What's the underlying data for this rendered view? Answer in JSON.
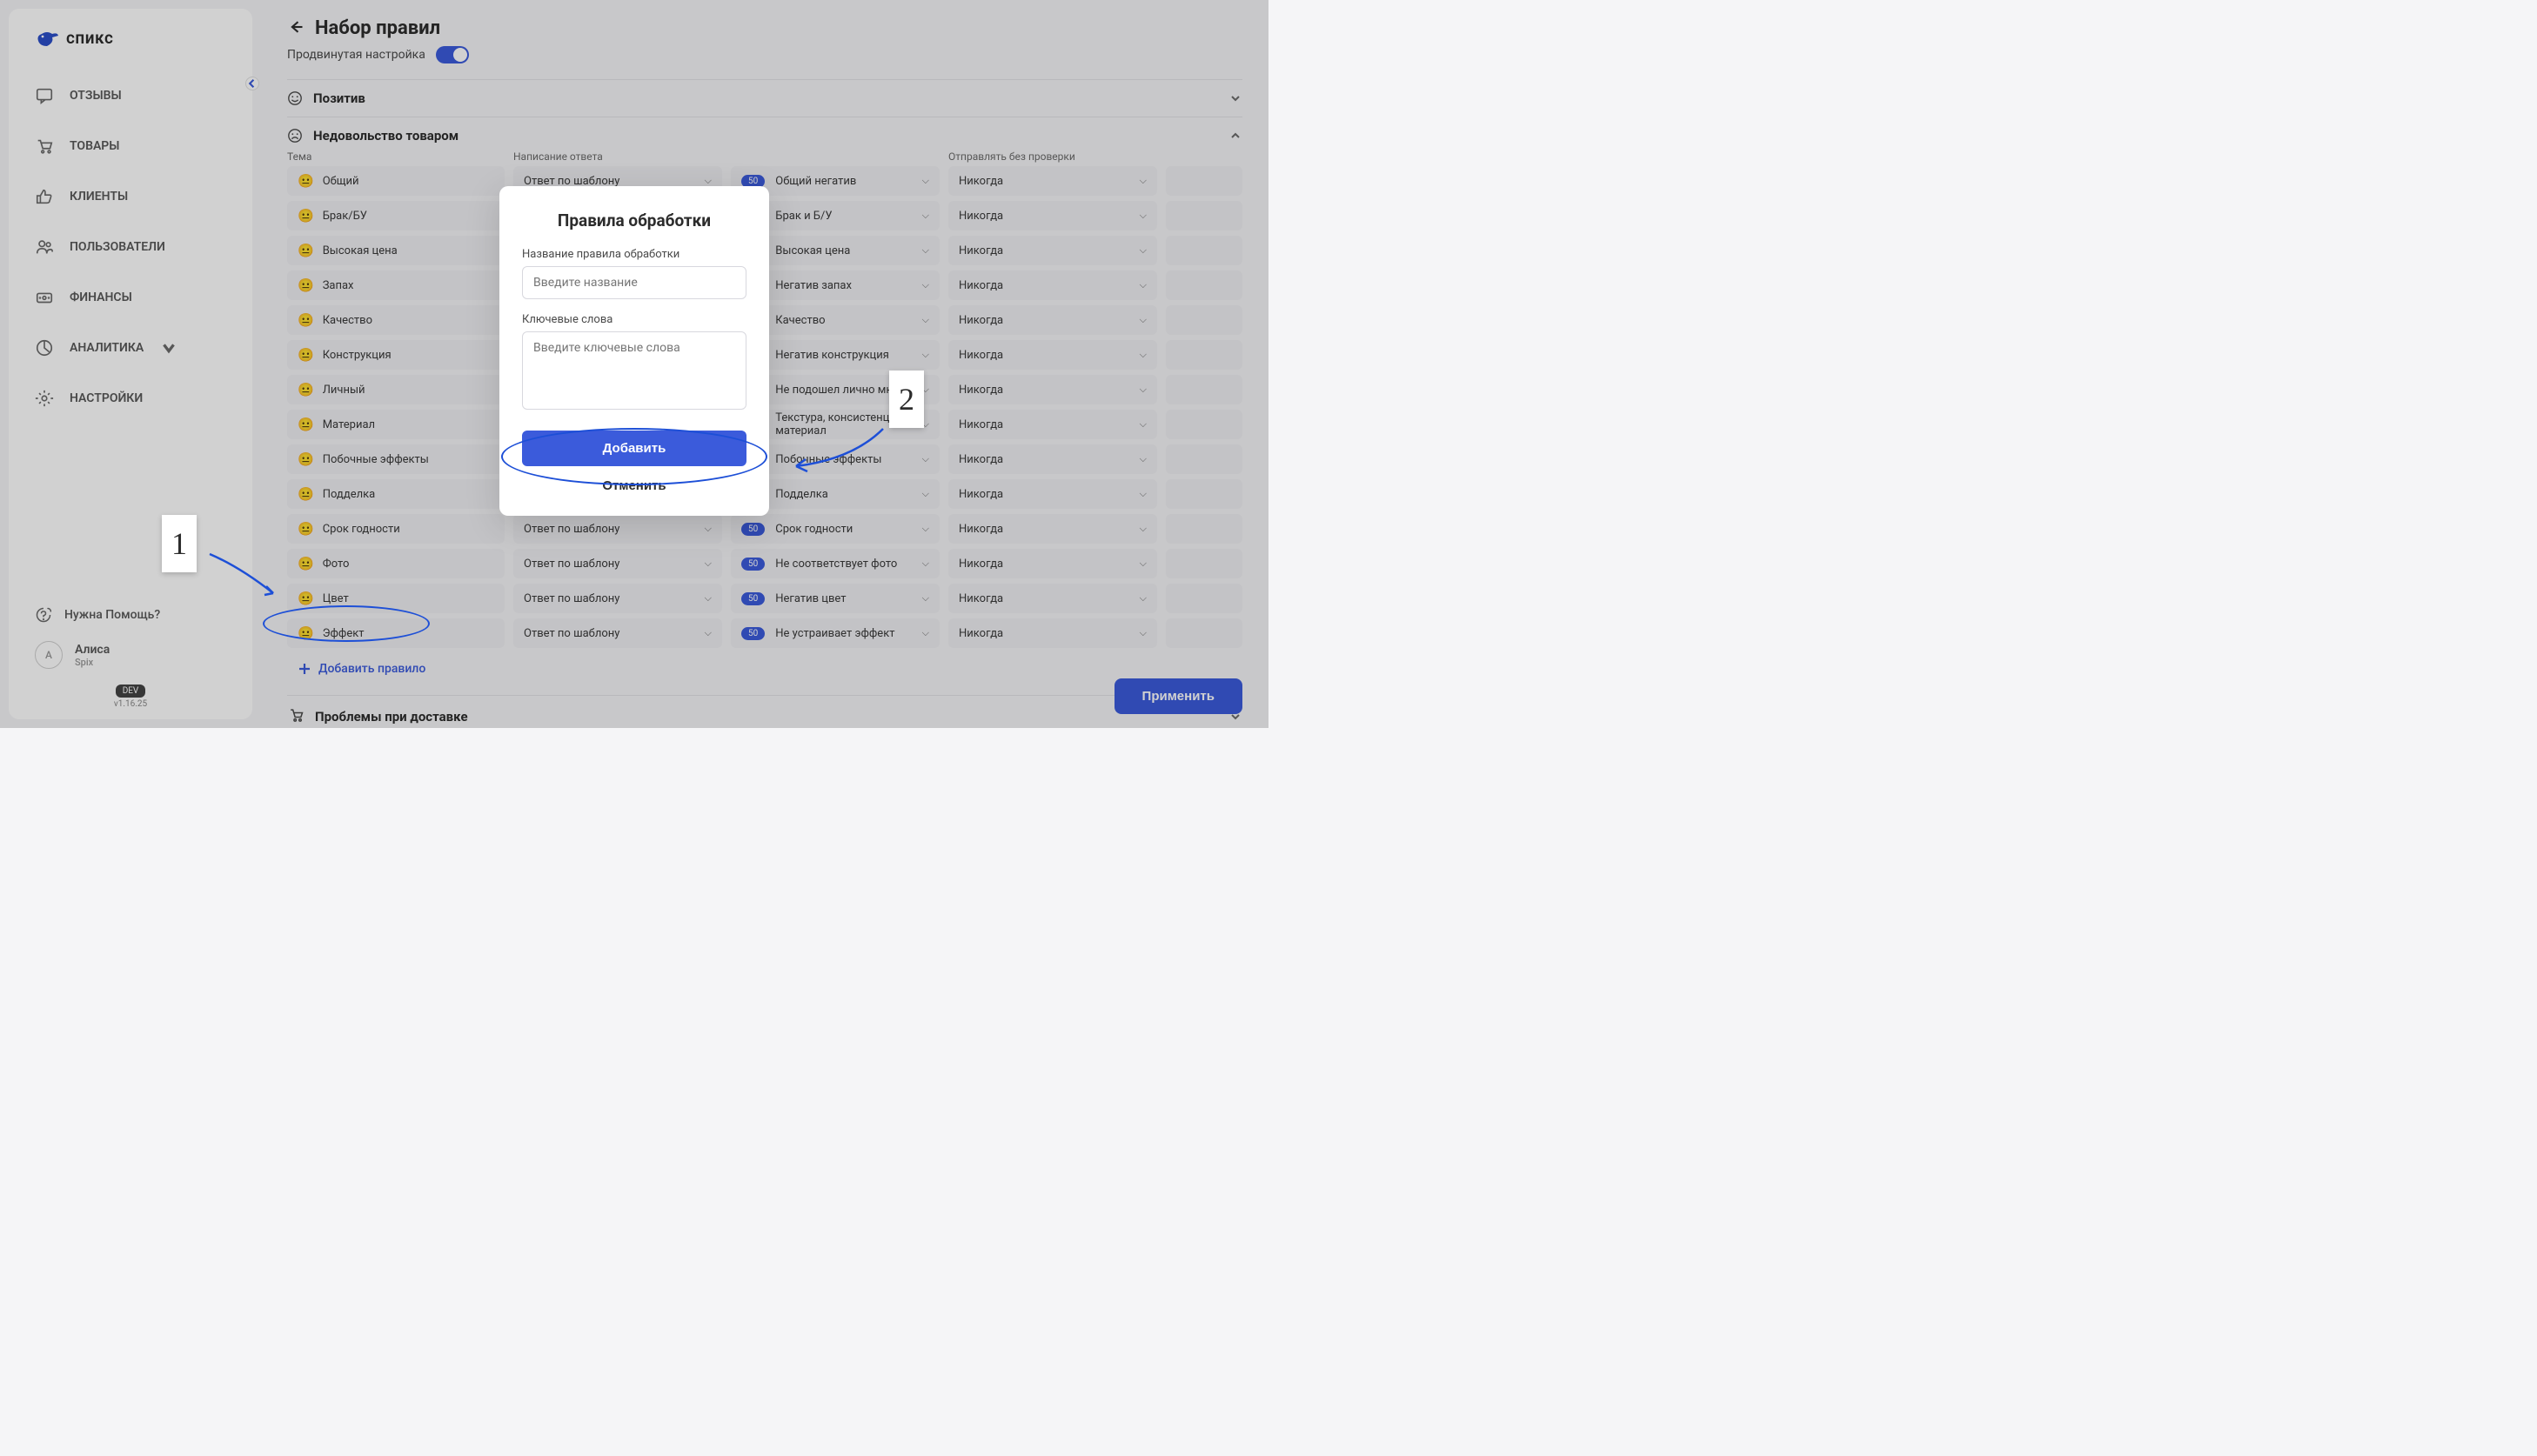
{
  "logo": {
    "text": "спикс"
  },
  "nav": {
    "items": [
      {
        "label": "ОТЗЫВЫ"
      },
      {
        "label": "ТОВАРЫ"
      },
      {
        "label": "КЛИЕНТЫ"
      },
      {
        "label": "ПОЛЬЗОВАТЕЛИ"
      },
      {
        "label": "ФИНАНСЫ"
      },
      {
        "label": "АНАЛИТИКА"
      },
      {
        "label": "НАСТРОЙКИ"
      }
    ]
  },
  "sidebar_footer": {
    "help": "Нужна Помощь?",
    "user_name": "Алиса",
    "user_org": "Spix",
    "dev_badge": "DEV",
    "version": "v1.16.25"
  },
  "header": {
    "title": "Набор правил",
    "advanced_label": "Продвинутая настройка"
  },
  "sections": {
    "positive": "Позитив",
    "dissatisfaction": "Недовольство товаром",
    "delivery": "Проблемы при доставке"
  },
  "columns": {
    "theme": "Тема",
    "writing": "Написание ответа",
    "send": "Отправлять без проверки"
  },
  "select_values": {
    "template_answer": "Ответ по шаблону",
    "never": "Никогда",
    "badge": "50"
  },
  "rules": [
    {
      "theme": "Общий",
      "template": "Общий негатив"
    },
    {
      "theme": "Брак/БУ",
      "template": "Брак и Б/У"
    },
    {
      "theme": "Высокая цена",
      "template": "Высокая цена"
    },
    {
      "theme": "Запах",
      "template": "Негатив запах"
    },
    {
      "theme": "Качество",
      "template": "Качество"
    },
    {
      "theme": "Конструкция",
      "template": "Негатив конструкция"
    },
    {
      "theme": "Личный",
      "template": "Не подошел лично мне"
    },
    {
      "theme": "Материал",
      "template": "Текстура, консистенция, материал"
    },
    {
      "theme": "Побочные эффекты",
      "template": "Побочные эффекты"
    },
    {
      "theme": "Подделка",
      "template": "Подделка"
    },
    {
      "theme": "Срок годности",
      "template": "Срок годности"
    },
    {
      "theme": "Фото",
      "template": "Не соответствует фото"
    },
    {
      "theme": "Цвет",
      "template": "Негатив цвет"
    },
    {
      "theme": "Эффект",
      "template": "Не устраивает эффект"
    }
  ],
  "add_rule": "Добавить правило",
  "apply": "Применить",
  "modal": {
    "title": "Правила обработки",
    "name_label": "Название правила обработки",
    "name_placeholder": "Введите название",
    "keywords_label": "Ключевые слова",
    "keywords_placeholder": "Введите ключевые слова",
    "add": "Добавить",
    "cancel": "Отменить"
  },
  "annotations": {
    "one": "1",
    "two": "2"
  }
}
